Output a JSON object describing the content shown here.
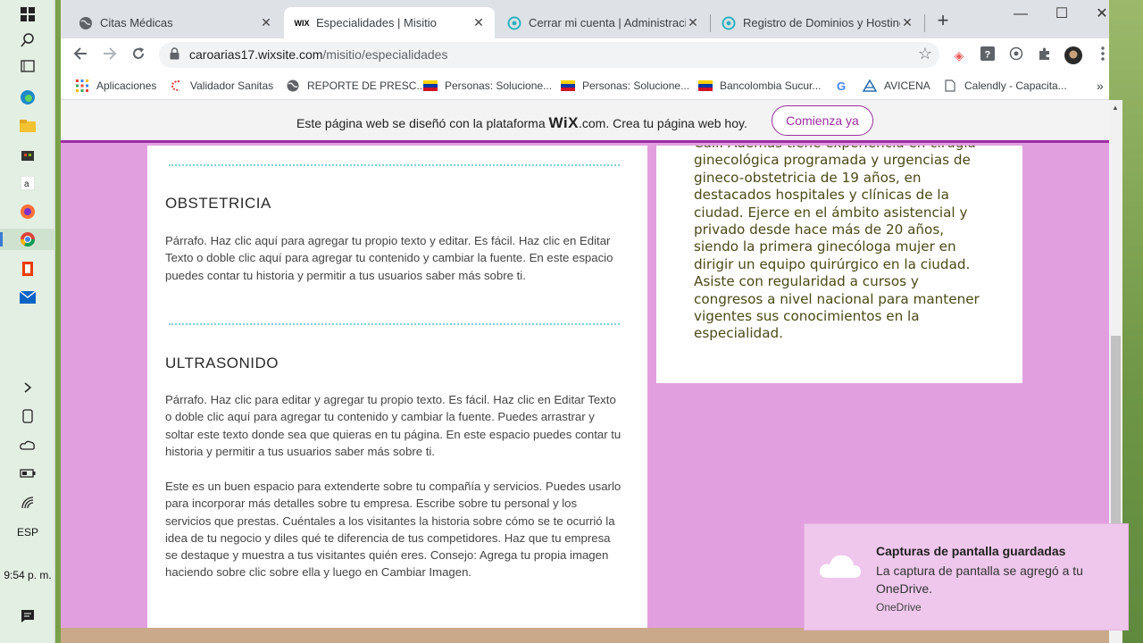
{
  "taskbar": {
    "language": "ESP",
    "time": "9:54 p. m."
  },
  "tabs": [
    {
      "title": "Citas Médicas",
      "icon": "globe-icon",
      "active": false
    },
    {
      "title": "Especialidades | Misitio",
      "icon": "wix-icon",
      "active": true
    },
    {
      "title": "Cerrar mi cuenta | Administración",
      "icon": "hosting-icon",
      "active": false
    },
    {
      "title": "Registro de Dominios y Hosting",
      "icon": "hosting-icon",
      "active": false
    }
  ],
  "address": {
    "domain": "caroarias17.wixsite.com",
    "path": "/misitio/especialidades"
  },
  "bookmarks": [
    {
      "label": "Aplicaciones",
      "icon": "apps-grid-icon"
    },
    {
      "label": "Validador Sanitas",
      "icon": "sanitas-icon"
    },
    {
      "label": "REPORTE DE PRESC...",
      "icon": "globe-icon"
    },
    {
      "label": "Personas: Solucione...",
      "icon": "bancolombia-icon"
    },
    {
      "label": "Personas: Solucione...",
      "icon": "bancolombia-icon"
    },
    {
      "label": "Bancolombia Sucur...",
      "icon": "bancolombia-icon"
    },
    {
      "label": "",
      "icon": "google-icon"
    },
    {
      "label": "AVICENA",
      "icon": "avicena-icon"
    },
    {
      "label": "Calendly - Capacita...",
      "icon": "page-icon"
    }
  ],
  "wix_banner": {
    "prefix": "Este página web se diseñó con la plataforma",
    "brand": "WiX",
    "suffix": ".com. Crea tu página web hoy.",
    "cta": "Comienza ya"
  },
  "sections": [
    {
      "title": "OBSTETRICIA",
      "paragraphs": [
        "Párrafo. Haz clic aquí para agregar tu propio texto y editar. Es fácil. Haz clic en Editar Texto o doble clic aquí para agregar tu contenido y cambiar la fuente. En este espacio puedes contar tu historia y permitir a tus usuarios saber más sobre ti."
      ]
    },
    {
      "title": "ULTRASONIDO",
      "paragraphs": [
        "Párrafo. Haz clic para editar y agregar tu propio texto. Es fácil. Haz clic en Editar Texto o doble clic aquí para agregar tu contenido y cambiar la fuente. Puedes arrastrar y soltar este texto donde sea que quieras en tu página. En este espacio puedes contar tu historia y permitir a tus usuarios saber más sobre ti.",
        "Este es un buen espacio para extenderte sobre tu compañía y servicios. Puedes usarlo para incorporar más detalles sobre tu empresa. Escribe sobre tu personal y los servicios que prestas. Cuéntales a los visitantes la historia sobre cómo se te ocurrió la idea de tu negocio y diles qué te diferencia de tus competidores. Haz que tu empresa se destaque y muestra a tus visitantes quién eres. Consejo: Agrega tu propia imagen haciendo sobre clic sobre ella y luego en Cambiar Imagen."
      ]
    }
  ],
  "bio": "Cali. Además tiene experiencia en cirugía ginecológica programada y urgencias de gineco-obstetricia de 19 años, en destacados hospitales y clínicas de la ciudad. Ejerce en el ámbito asistencial y privado desde hace más de 20 años, siendo la primera ginecóloga mujer en dirigir un equipo quirúrgico en la ciudad. Asiste con regularidad a cursos y congresos a nivel nacional para mantener vigentes sus conocimientos en la especialidad.",
  "toast": {
    "title": "Capturas de pantalla guardadas",
    "body": "La captura de pantalla se agregó a tu OneDrive.",
    "source": "OneDrive"
  },
  "colors": {
    "page_bg": "#e29fe0",
    "wix_accent": "#9b2fa0",
    "divider": "#7fd0d8",
    "bio_text": "#4a4a1a"
  }
}
